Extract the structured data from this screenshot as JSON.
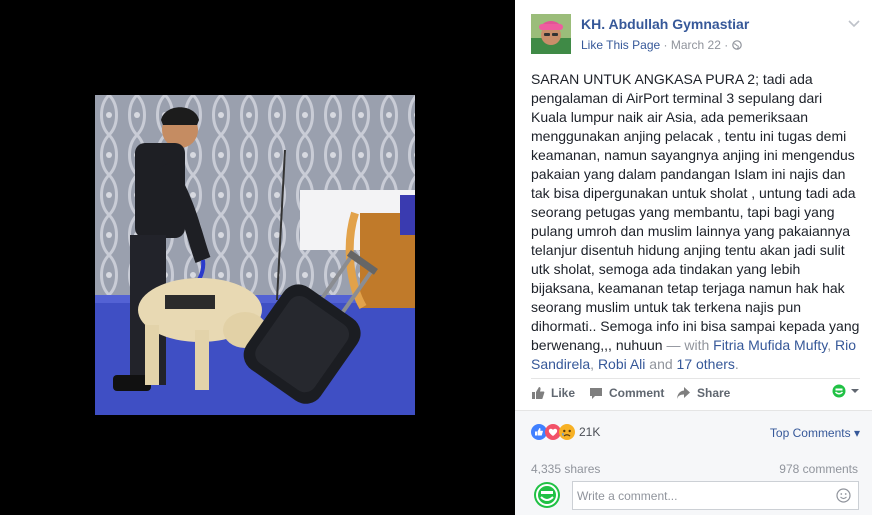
{
  "post": {
    "author": "KH. Abdullah Gymnastiar",
    "like_page": "Like This Page",
    "dot": "·",
    "date": "March 22",
    "dot2": "·",
    "body": "SARAN UNTUK ANGKASA PURA 2; tadi ada pengalaman di AirPort terminal 3 sepulang dari Kuala lumpur naik air Asia, ada pemeriksaan menggunakan anjing pelacak , tentu ini tugas demi keamanan, namun sayangnya anjing ini mengendus pakaian yang dalam pandangan Islam ini najis dan tak bisa dipergunakan untuk sholat , untung tadi ada seorang petugas yang membantu, tapi bagi yang pulang umroh dan muslim lainnya yang pakaiannya telanjur disentuh hidung anjing tentu akan jadi sulit utk sholat, semoga ada tindakan yang lebih bijaksana, keamanan tetap terjaga namun hak hak seorang muslim untuk tak terkena najis pun dihormati.. Semoga info ini bisa sampai kepada yang berwenang,,, nuhuun",
    "with_sep": " — with ",
    "tag1": "Fitria Mufida Mufty",
    "comma1": ", ",
    "tag2": "Rio Sandirela",
    "comma2": ", ",
    "tag3": "Robi Ali",
    "and_sep": " and ",
    "tag_others": "17 others",
    "end": "."
  },
  "actions": {
    "like": "Like",
    "comment": "Comment",
    "share": "Share"
  },
  "feedback": {
    "reaction_count": "21K",
    "top_comments": "Top Comments",
    "top_comments_caret": "▾",
    "shares": "4,335 shares",
    "comments": "978 comments",
    "comment_placeholder": "Write a comment..."
  },
  "icons": [
    "chevron-down-icon",
    "globe-icon",
    "like-icon",
    "comment-icon",
    "share-icon",
    "emoticon-icon",
    "reaction-like-icon",
    "reaction-love-icon",
    "reaction-sad-icon",
    "smiley-icon"
  ],
  "colors": {
    "link": "#365899",
    "muted": "#90949c",
    "text": "#1d2129",
    "like_blue": "#4080ff",
    "love_red": "#f25268",
    "sad_yellow": "#f7b125",
    "emoticon_green": "#20c144"
  }
}
